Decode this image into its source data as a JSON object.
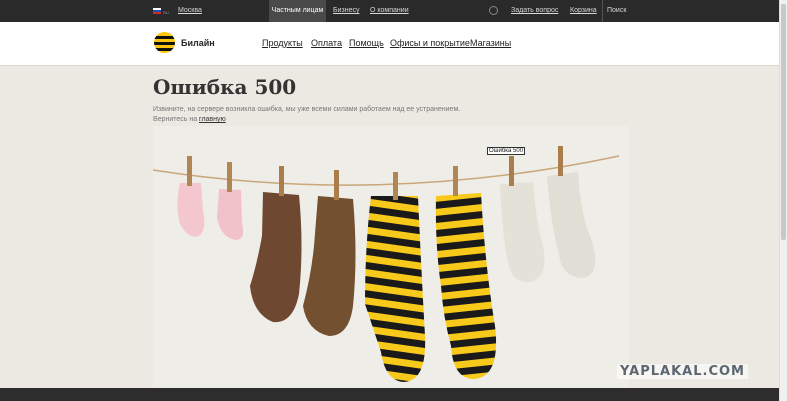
{
  "topbar": {
    "lang": "RU",
    "city": "Москва",
    "segments": [
      "Частным лицам",
      "Бизнесу",
      "О компании"
    ],
    "ask": "Задать вопрос",
    "cart": "Корзина",
    "search": "Поиск"
  },
  "header": {
    "brand": "Билайн",
    "nav": [
      "Продукты",
      "Оплата",
      "Помощь",
      "Офисы и покрытие",
      "Магазины"
    ]
  },
  "error": {
    "title": "Ошибка 500",
    "message": "Извините, на сервере возникла ошибка, мы уже всеми силами работаем над ее устранением.",
    "back_prefix": "Вернитесь на ",
    "back_link": "главную"
  },
  "tooltip": "Ошибка 500",
  "watermark": "YAPLAKAL.COM",
  "colors": {
    "brand_yellow": "#fcc60d",
    "topbar": "#2a2a2a",
    "sock_pink": "#f4c6cd",
    "sock_brown": "#6e4830",
    "sock_stripe_black": "#1a1a1a",
    "sock_white": "#e4e1d8"
  }
}
